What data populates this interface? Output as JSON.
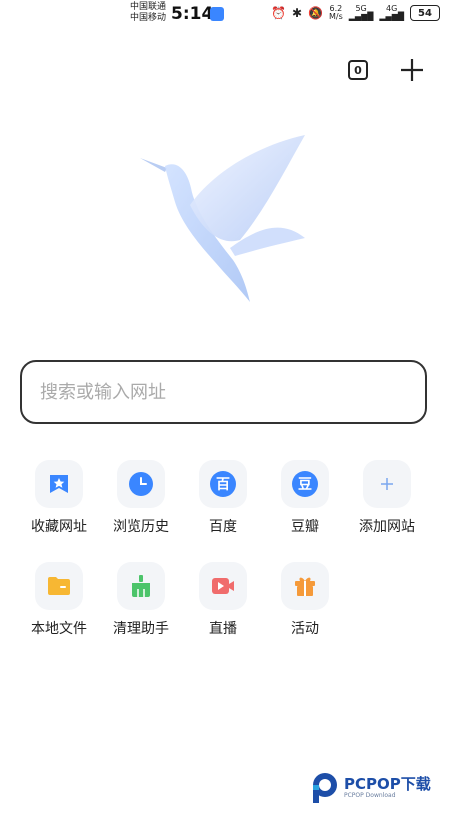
{
  "status_bar": {
    "carrier_1": "中国联通",
    "carrier_2": "中国移动",
    "time": "5:14",
    "net_speed_value": "6.2",
    "net_speed_unit": "M/s",
    "signal_1_label": "5G",
    "signal_2_label": "4G",
    "battery": "54"
  },
  "top_actions": {
    "tab_count": "0"
  },
  "search": {
    "placeholder": "搜索或输入网址"
  },
  "shortcuts_row_1": [
    {
      "label": "收藏网址",
      "icon": "bookmark-star-icon"
    },
    {
      "label": "浏览历史",
      "icon": "clock-icon"
    },
    {
      "label": "百度",
      "icon": "baidu-icon",
      "glyph": "百"
    },
    {
      "label": "豆瓣",
      "icon": "douban-icon",
      "glyph": "豆"
    },
    {
      "label": "添加网站",
      "icon": "plus-icon"
    }
  ],
  "shortcuts_row_2": [
    {
      "label": "本地文件",
      "icon": "folder-icon"
    },
    {
      "label": "清理助手",
      "icon": "broom-icon"
    },
    {
      "label": "直播",
      "icon": "video-icon"
    },
    {
      "label": "活动",
      "icon": "gift-icon"
    }
  ],
  "watermark": {
    "brand": "PCPOP下载",
    "sub": "PCPOP Download"
  },
  "colors": {
    "accent_blue": "#3a86ff",
    "tile_bg": "#f3f5f8",
    "folder_yellow": "#f7b733",
    "broom_green": "#4cc46a",
    "video_red": "#f06c6c",
    "gift_orange": "#f59a3a"
  }
}
